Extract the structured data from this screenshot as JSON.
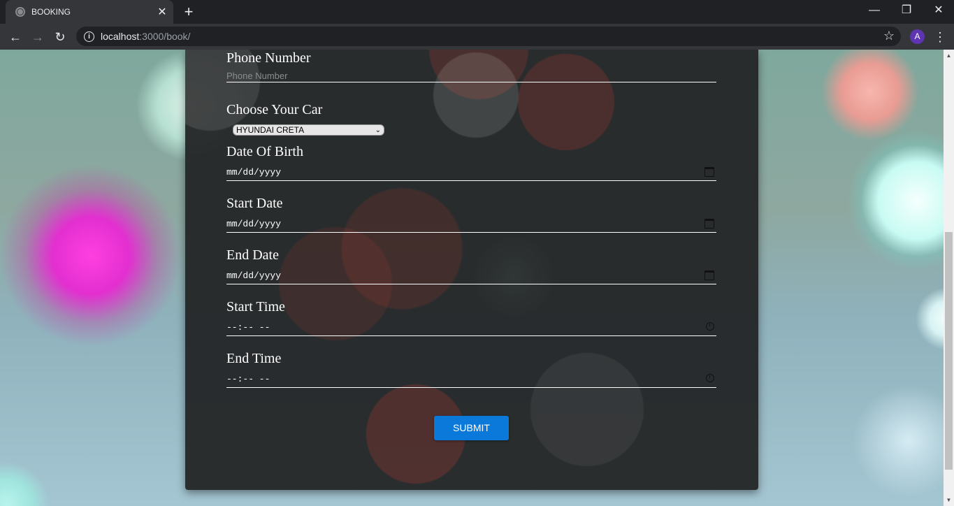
{
  "browser": {
    "tab_title": "BOOKING",
    "url_host": "localhost",
    "url_path": ":3000/book/",
    "profile_initial": "A"
  },
  "form": {
    "fields": [
      {
        "label": "Phone Number",
        "placeholder": "Phone Number",
        "type": "text"
      },
      {
        "label": "Choose Your Car",
        "type": "select",
        "value": "HYUNDAI CRETA"
      },
      {
        "label": "Date Of Birth",
        "type": "date",
        "value": "mm/dd/yyyy"
      },
      {
        "label": "Start Date",
        "type": "date",
        "value": "mm/dd/yyyy"
      },
      {
        "label": "End Date",
        "type": "date",
        "value": "mm/dd/yyyy"
      },
      {
        "label": "Start Time",
        "type": "time",
        "value": "--:-- --"
      },
      {
        "label": "End Time",
        "type": "time",
        "value": "--:-- --"
      }
    ],
    "submit_label": "SUBMIT"
  },
  "colors": {
    "submit_button": "#0b79d9",
    "card_background": "#242628",
    "label_text": "#ffffff"
  },
  "icons": [
    "globe-icon",
    "close-icon",
    "plus-icon",
    "back-icon",
    "forward-icon",
    "reload-icon",
    "info-icon",
    "star-icon",
    "menu-icon",
    "calendar-icon",
    "clock-icon",
    "chevron-down-icon"
  ]
}
